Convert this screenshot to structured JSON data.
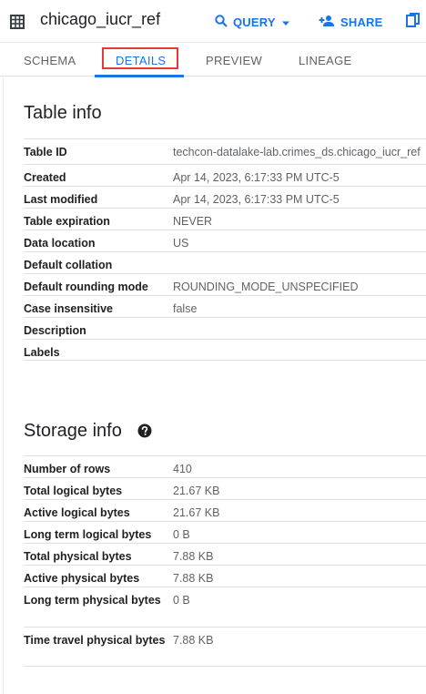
{
  "header": {
    "title": "chicago_iucr_ref",
    "table_icon": "table-grid-icon",
    "query_label": "QUERY",
    "share_label": "SHARE",
    "copy_icon": "copy-icon",
    "accent": "#1a73e8"
  },
  "tabs": [
    {
      "label": "SCHEMA",
      "active": false
    },
    {
      "label": "DETAILS",
      "active": true
    },
    {
      "label": "PREVIEW",
      "active": false
    },
    {
      "label": "LINEAGE",
      "active": false
    }
  ],
  "table_info": {
    "title": "Table info",
    "rows": [
      {
        "label": "Table ID",
        "value": "techcon-datalake-lab.crimes_ds.chicago_iucr_ref"
      },
      {
        "label": "Created",
        "value": "Apr 14, 2023, 6:17:33 PM UTC-5"
      },
      {
        "label": "Last modified",
        "value": "Apr 14, 2023, 6:17:33 PM UTC-5"
      },
      {
        "label": "Table expiration",
        "value": "NEVER"
      },
      {
        "label": "Data location",
        "value": "US"
      },
      {
        "label": "Default collation",
        "value": ""
      },
      {
        "label": "Default rounding mode",
        "value": "ROUNDING_MODE_UNSPECIFIED"
      },
      {
        "label": "Case insensitive",
        "value": "false"
      },
      {
        "label": "Description",
        "value": ""
      },
      {
        "label": "Labels",
        "value": ""
      }
    ]
  },
  "storage_info": {
    "title": "Storage info",
    "help_icon": "help-circle-icon",
    "rows": [
      {
        "label": "Number of rows",
        "value": "410"
      },
      {
        "label": "Total logical bytes",
        "value": "21.67 KB"
      },
      {
        "label": "Active logical bytes",
        "value": "21.67 KB"
      },
      {
        "label": "Long term logical bytes",
        "value": "0 B"
      },
      {
        "label": "Total physical bytes",
        "value": "7.88 KB"
      },
      {
        "label": "Active physical bytes",
        "value": "7.88 KB"
      },
      {
        "label": "Long term physical bytes",
        "value": "0 B"
      },
      {
        "label": "Time travel physical bytes",
        "value": "7.88 KB"
      }
    ]
  }
}
